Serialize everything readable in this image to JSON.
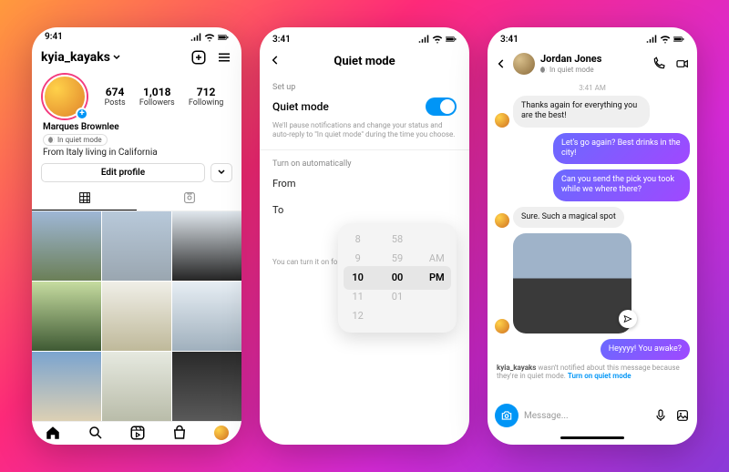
{
  "status": {
    "time": "9:41",
    "time2": "3:41",
    "time3": "3:41"
  },
  "profile": {
    "username": "kyia_kayaks",
    "stats": {
      "posts_n": "674",
      "posts_l": "Posts",
      "followers_n": "1,018",
      "followers_l": "Followers",
      "following_n": "712",
      "following_l": "Following"
    },
    "display_name": "Marques Brownlee",
    "quiet_label": "In quiet mode",
    "bio": "From Italy living in California",
    "edit_label": "Edit profile"
  },
  "quiet": {
    "header": "Quiet mode",
    "section_setup": "Set up",
    "toggle_label": "Quiet mode",
    "desc": "We'll pause notifications and change your status and auto-reply to \"In quiet mode\" during the time you choose.",
    "section_auto": "Turn on automatically",
    "from_label": "From",
    "to_label": "To",
    "hint": "You can turn it on for",
    "picker": {
      "h": [
        "8",
        "9",
        "10",
        "11",
        "12"
      ],
      "m": [
        "58",
        "59",
        "00",
        "01",
        ""
      ],
      "ap": [
        "",
        "AM",
        "PM",
        "",
        ""
      ]
    }
  },
  "chat": {
    "name": "Jordan Jones",
    "sub": "In quiet mode",
    "time": "3:41 AM",
    "m1": "Thanks again for everything you are the best!",
    "m2": "Let's go again? Best drinks in the city!",
    "m3": "Can you send the pick you took while we where there?",
    "m4": "Sure. Such a magical spot",
    "m5": "Heyyyy! You awake?",
    "notice_user": "kyia_kayaks",
    "notice_text": " wasn't notified about this message because they're in quiet mode. ",
    "notice_link": "Turn on quiet mode",
    "placeholder": "Message..."
  }
}
